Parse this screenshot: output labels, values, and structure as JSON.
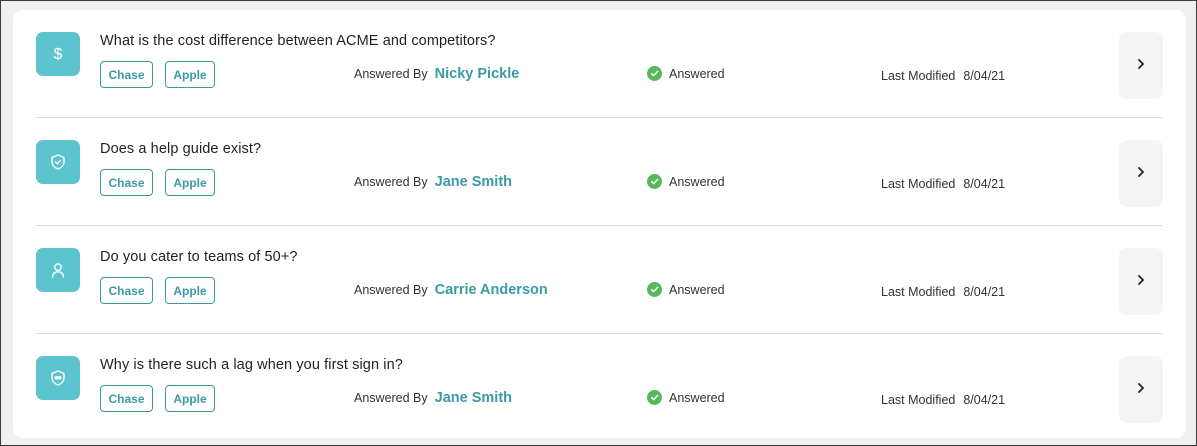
{
  "questions": [
    {
      "icon": "dollar-icon",
      "title": "What is the cost difference between ACME and competitors?",
      "tags": [
        "Chase",
        "Apple"
      ],
      "answered_by_label": "Answered By",
      "answered_by": "Nicky Pickle",
      "status": "Answered",
      "modified_label": "Last Modified",
      "modified_date": "8/04/21"
    },
    {
      "icon": "shield-check-icon",
      "title": "Does a help guide exist?",
      "tags": [
        "Chase",
        "Apple"
      ],
      "answered_by_label": "Answered By",
      "answered_by": "Jane Smith",
      "status": "Answered",
      "modified_label": "Last Modified",
      "modified_date": "8/04/21"
    },
    {
      "icon": "user-icon",
      "title": "Do you cater to teams of 50+?",
      "tags": [
        "Chase",
        "Apple"
      ],
      "answered_by_label": "Answered By",
      "answered_by": "Carrie Anderson",
      "status": "Answered",
      "modified_label": "Last Modified",
      "modified_date": "8/04/21"
    },
    {
      "icon": "vpn-shield-icon",
      "title": "Why is there such a lag when you first sign in?",
      "tags": [
        "Chase",
        "Apple"
      ],
      "answered_by_label": "Answered By",
      "answered_by": "Jane Smith",
      "status": "Answered",
      "modified_label": "Last Modified",
      "modified_date": "8/04/21"
    }
  ],
  "colors": {
    "accent": "#3a9aa6",
    "icon_bg": "#5bc4cc",
    "status_green": "#57b85a"
  }
}
